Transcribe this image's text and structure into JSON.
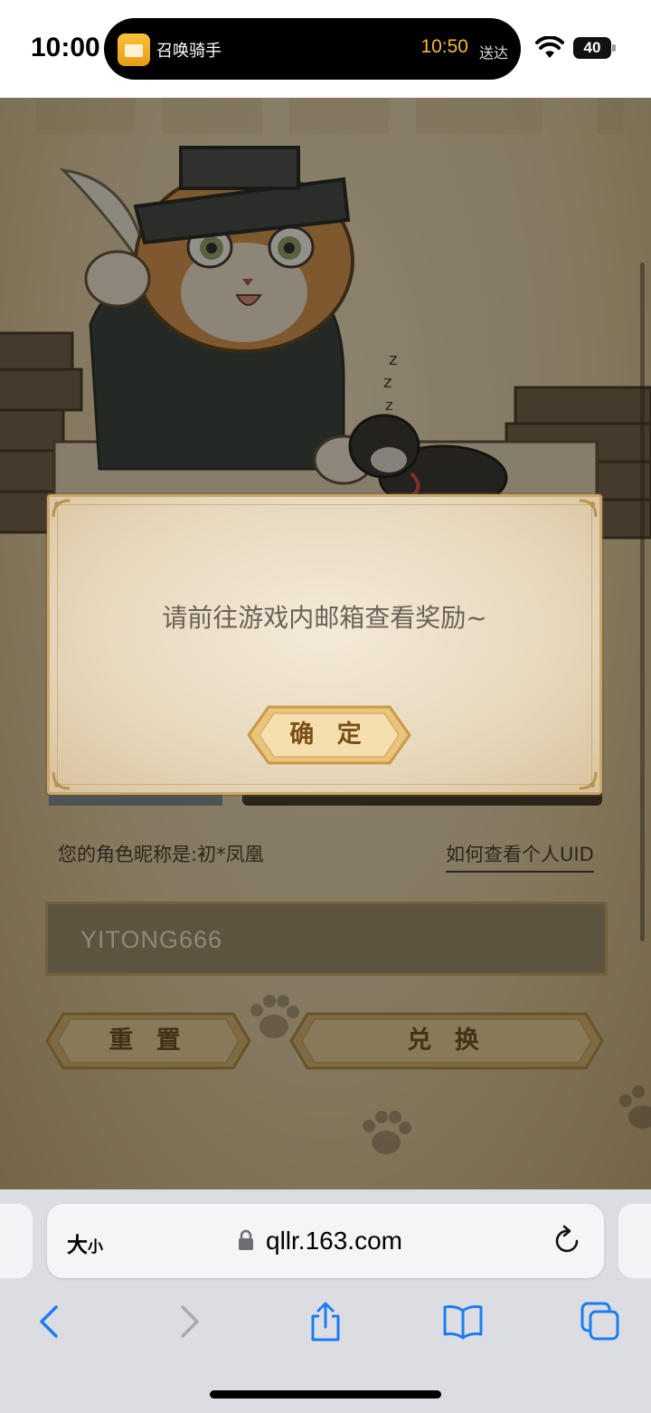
{
  "status_bar": {
    "time": "10:00",
    "live_activity": {
      "app_name": "召唤骑手",
      "eta_time": "10:50",
      "eta_suffix": "送达"
    },
    "battery_level": "40"
  },
  "page": {
    "nickname_text": "您的角色昵称是:初*凤凰",
    "uid_help_link": "如何查看个人UID",
    "code_value": "YITONG666",
    "reset_label": "重 置",
    "redeem_label": "兑 换"
  },
  "modal": {
    "message": "请前往游戏内邮箱查看奖励~",
    "confirm_label": "确 定"
  },
  "browser": {
    "text_size_big": "大",
    "text_size_small": "小",
    "url": "qllr.163.com"
  },
  "colors": {
    "accent_gold": "#caa86b",
    "button_text": "#6b4a1d",
    "safari_blue": "#1a7ef2"
  }
}
